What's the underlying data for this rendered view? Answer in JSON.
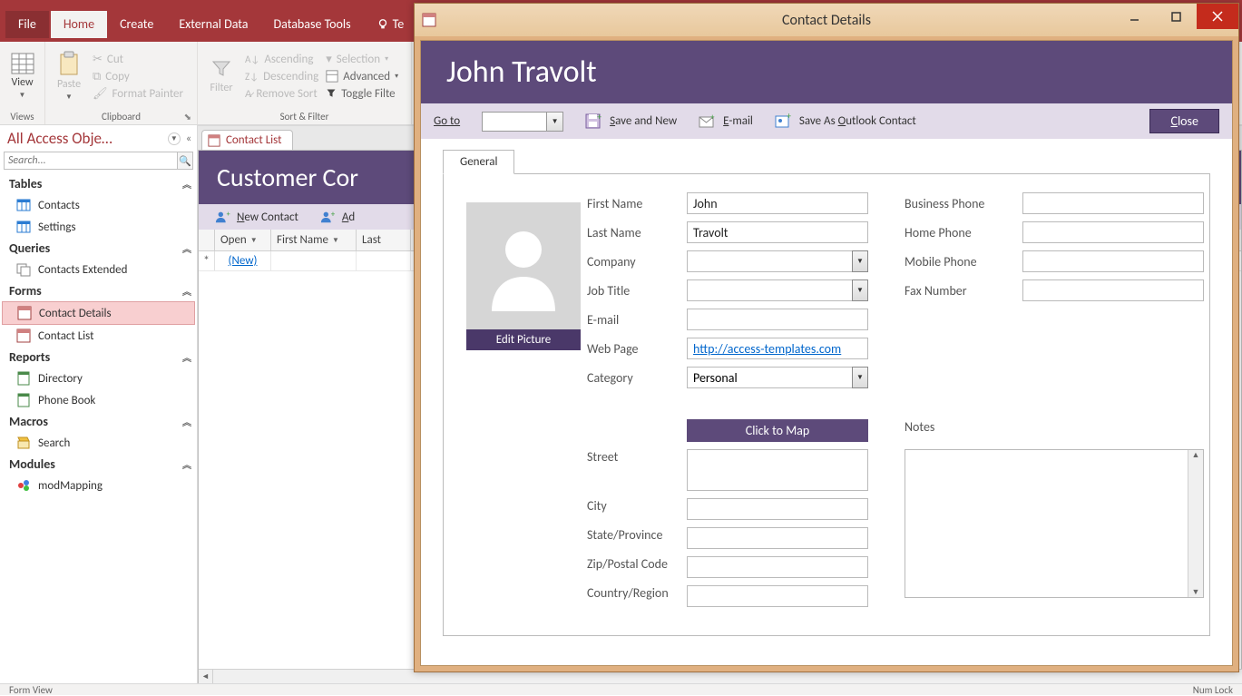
{
  "ribbon": {
    "tabs": {
      "file": "File",
      "home": "Home",
      "create": "Create",
      "external": "External Data",
      "dbtools": "Database Tools",
      "tell": "Te"
    },
    "views": {
      "big": "View",
      "group": "Views"
    },
    "clipboard": {
      "paste": "Paste",
      "cut": "Cut",
      "copy": "Copy",
      "painter": "Format Painter",
      "group": "Clipboard"
    },
    "sortfilter": {
      "filter": "Filter",
      "asc": "Ascending",
      "desc": "Descending",
      "remove": "Remove Sort",
      "selection": "Selection",
      "advanced": "Advanced",
      "toggle": "Toggle Filte",
      "group": "Sort & Filter"
    }
  },
  "nav": {
    "title": "All Access Obje…",
    "search_placeholder": "Search...",
    "cats": {
      "tables": "Tables",
      "queries": "Queries",
      "forms": "Forms",
      "reports": "Reports",
      "macros": "Macros",
      "modules": "Modules"
    },
    "items": {
      "contacts": "Contacts",
      "settings": "Settings",
      "contacts_ext": "Contacts Extended",
      "contact_details": "Contact Details",
      "contact_list": "Contact List",
      "directory": "Directory",
      "phonebook": "Phone Book",
      "search": "Search",
      "modmapping": "modMapping"
    }
  },
  "doc": {
    "tab": "Contact List",
    "banner": "Customer Cor",
    "toolbar": {
      "newcontact": "New Contact",
      "add": "Ad"
    },
    "cols": {
      "open": "Open",
      "first": "First Name",
      "last": "Last"
    },
    "newrow": "(New)"
  },
  "statusbar": {
    "left": "Form View",
    "right": "Num Lock"
  },
  "dialog": {
    "title": "Contact Details",
    "banner": "John Travolt",
    "toolbar": {
      "goto": "Go to",
      "savenew": "Save and New",
      "email": "E-mail",
      "outlook": "Save As Outlook Contact",
      "close": "Close"
    },
    "tab_general": "General",
    "edit_picture": "Edit Picture",
    "labels": {
      "first_name": "First Name",
      "last_name": "Last Name",
      "company": "Company",
      "job_title": "Job Title",
      "email": "E-mail",
      "webpage": "Web Page",
      "category": "Category",
      "bus_phone": "Business Phone",
      "home_phone": "Home Phone",
      "mob_phone": "Mobile Phone",
      "fax": "Fax Number",
      "street": "Street",
      "city": "City",
      "state": "State/Province",
      "zip": "Zip/Postal Code",
      "country": "Country/Region",
      "notes": "Notes"
    },
    "values": {
      "first_name": "John",
      "last_name": "Travolt",
      "company": "",
      "job_title": "",
      "email": "",
      "webpage": "http://access-templates.com",
      "category": "Personal",
      "bus_phone": "",
      "home_phone": "",
      "mob_phone": "",
      "fax": "",
      "street": "",
      "city": "",
      "state": "",
      "zip": "",
      "country": "",
      "notes": ""
    },
    "click_map": "Click to Map"
  }
}
